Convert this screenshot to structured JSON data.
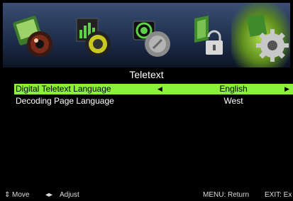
{
  "header": {
    "title": "Teletext"
  },
  "icons": [
    "picture-icon",
    "sound-icon",
    "channel-icon",
    "lock-icon",
    "setup-icon"
  ],
  "settings": [
    {
      "label": "Digital Teletext Language",
      "value": "English",
      "selected": true
    },
    {
      "label": "Decoding Page Language",
      "value": "West",
      "selected": false
    }
  ],
  "footer": {
    "move_glyph": "⇕",
    "move_label": "Move",
    "adjust_glyph": "◂▸",
    "adjust_label": "Adjust",
    "menu_label": "MENU: Return",
    "exit_label": "EXIT: Ex"
  },
  "colors": {
    "highlight": "#8af03a",
    "iconbar": "#2a3b5c",
    "background": "#000000"
  }
}
